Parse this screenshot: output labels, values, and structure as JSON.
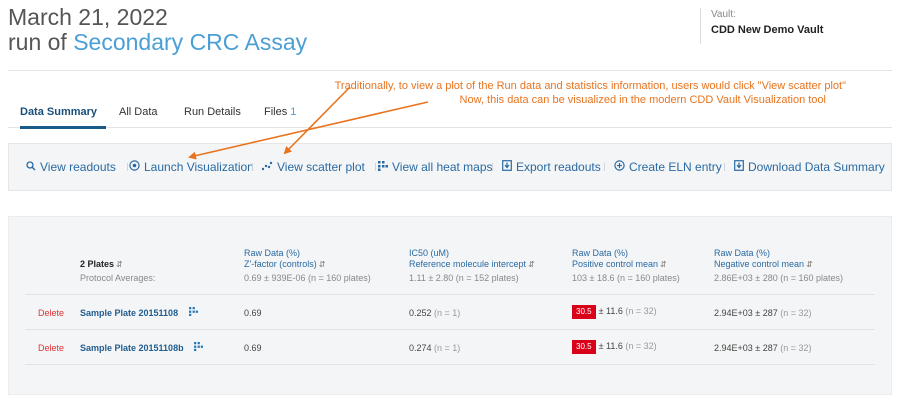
{
  "header": {
    "date": "March 21, 2022",
    "run_prefix": "run of ",
    "protocol_name": "Secondary CRC Assay",
    "vault_label": "Vault:",
    "vault_name": "CDD New Demo Vault"
  },
  "annotation": {
    "line1": "Traditionally, to view a plot of the Run data and statistics information, users would click \"View scatter plot\"",
    "line2": "Now, this data can be visualized in the modern CDD Vault Visualization tool",
    "color": "#e8741f"
  },
  "tabs": [
    {
      "label": "Data Summary",
      "active": true
    },
    {
      "label": "All Data"
    },
    {
      "label": "Run Details"
    },
    {
      "label": "Files",
      "count": "1"
    }
  ],
  "toolbar": [
    {
      "label": "View readouts",
      "icon": "search-icon"
    },
    {
      "label": "Launch Visualization",
      "icon": "visualization-icon"
    },
    {
      "label": "View scatter plot",
      "icon": "scatter-plot-icon"
    },
    {
      "label": "View all heat maps",
      "icon": "heat-map-icon"
    },
    {
      "label": "Export readouts",
      "icon": "export-icon"
    },
    {
      "label": "Create ELN entry",
      "icon": "plus-circle-icon"
    },
    {
      "label": "Download Data Summary",
      "icon": "download-icon"
    }
  ],
  "table": {
    "plates_header": "2 Plates",
    "protocol_averages_label": "Protocol Averages:",
    "columns": [
      {
        "line1": "Raw Data (%)",
        "line2": "Z'-factor (controls)",
        "avg": "0.69 ± 939E-06 (n = 160 plates)"
      },
      {
        "line1": "IC50 (uM)",
        "line2": "Reference molecule intercept",
        "avg": "1.11 ± 2.80 (n = 152 plates)"
      },
      {
        "line1": "Raw Data (%)",
        "line2": "Positive control mean",
        "avg": "103 ± 18.6 (n = 160 plates)"
      },
      {
        "line1": "Raw Data (%)",
        "line2": "Negative control mean",
        "avg": "2.86E+03 ± 280 (n = 160 plates)"
      }
    ],
    "rows": [
      {
        "delete_label": "Delete",
        "plate": "Sample Plate 20151108",
        "zfactor": "0.69",
        "ic50": "0.252",
        "ic50_n": "(n = 1)",
        "pos_highlight": "30.5",
        "pos_rest": "± 11.6",
        "pos_n": "(n = 32)",
        "neg": "2.94E+03 ± 287",
        "neg_n": "(n = 32)"
      },
      {
        "delete_label": "Delete",
        "plate": "Sample Plate 20151108b",
        "zfactor": "0.69",
        "ic50": "0.274",
        "ic50_n": "(n = 1)",
        "pos_highlight": "30.5",
        "pos_rest": "± 11.6",
        "pos_n": "(n = 32)",
        "neg": "2.94E+03 ± 287",
        "neg_n": "(n = 32)"
      }
    ]
  },
  "colors": {
    "link": "#2a6aa3",
    "accent_header": "#4a9fd5",
    "highlight_red": "#d9001a",
    "delete_red": "#dd3333"
  }
}
